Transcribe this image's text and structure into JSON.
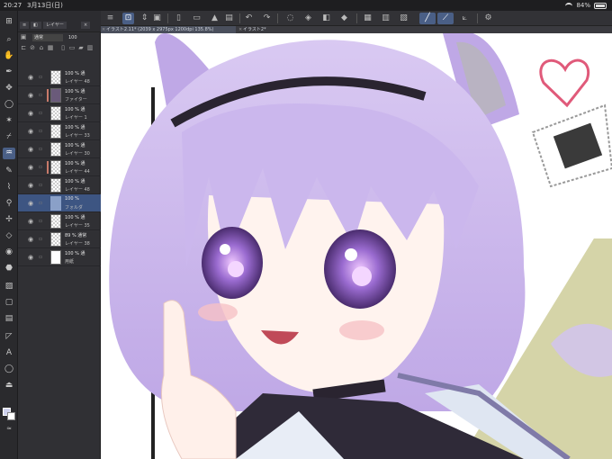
{
  "status": {
    "time": "20:27",
    "date": "3月13日(日)",
    "battery": "84%",
    "battery_level": 0.84
  },
  "toolbar_icons": [
    "menu-icon",
    "transform-icon",
    "frame-icon",
    "new-file-icon",
    "open-folder-icon",
    "export-icon",
    "save-icon",
    "undo-icon",
    "redo-icon",
    "select-icon",
    "fill-select-icon",
    "clear-icon",
    "transform-selection-icon",
    "grid-icon",
    "ruler-icon",
    "snap-icon",
    "ruler-snap-icon",
    "special-ruler-icon",
    "settings-icon"
  ],
  "tabs": [
    {
      "label": "イラスト2.11* (2039 x 2975px 1200dpi 135.8%)",
      "active": true
    },
    {
      "label": "イラスト2*",
      "active": false
    }
  ],
  "tools": [
    "zoom-icon",
    "hand-icon",
    "pen-icon",
    "move-icon",
    "lasso-icon",
    "magic-wand-icon",
    "eyedropper-icon",
    "airbrush-icon",
    "pencil-icon",
    "brush-icon",
    "decoration-icon",
    "eraser-icon",
    "blend-icon",
    "fill-icon",
    "gradient-icon",
    "shape-icon",
    "frame-icon",
    "ruler-icon",
    "text-icon",
    "balloon-icon",
    "correct-line-icon"
  ],
  "layer_panel": {
    "tab_label": "レイヤー",
    "blend_mode": "通常",
    "opacity": "100",
    "layers": [
      {
        "pct": "100 % 通",
        "name": "レイヤー 48",
        "thumb": "check",
        "mark": ""
      },
      {
        "pct": "100 % 通",
        "name": "ファイター",
        "thumb": "art",
        "mark": "#c87a6a"
      },
      {
        "pct": "100 % 通",
        "name": "レイヤー 1",
        "thumb": "check",
        "mark": ""
      },
      {
        "pct": "100 % 通",
        "name": "レイヤー 33",
        "thumb": "check",
        "mark": ""
      },
      {
        "pct": "100 % 通",
        "name": "レイヤー 30",
        "thumb": "check",
        "mark": ""
      },
      {
        "pct": "100 % 通",
        "name": "レイヤー 44",
        "thumb": "check",
        "mark": "#c87a6a"
      },
      {
        "pct": "100 % 通",
        "name": "レイヤー 48",
        "thumb": "check",
        "mark": ""
      },
      {
        "pct": "100 %",
        "name": "フォルダ",
        "thumb": "folder",
        "mark": "",
        "selected": true
      },
      {
        "pct": "100 % 通",
        "name": "レイヤー 35",
        "thumb": "check",
        "mark": ""
      },
      {
        "pct": "89 % 通常",
        "name": "レイヤー 38",
        "thumb": "check",
        "mark": ""
      },
      {
        "pct": "100 % 通",
        "name": "用紙",
        "thumb": "solid",
        "mark": ""
      }
    ]
  },
  "colors": {
    "accent": "#4a5f86",
    "main_color": "#cfd2ee",
    "sub_color": "#ffffff",
    "hair": "#c9b6e8",
    "eye": "#8a5fc0",
    "heart": "#e05a7a",
    "triangle": "#d5d4a8"
  }
}
